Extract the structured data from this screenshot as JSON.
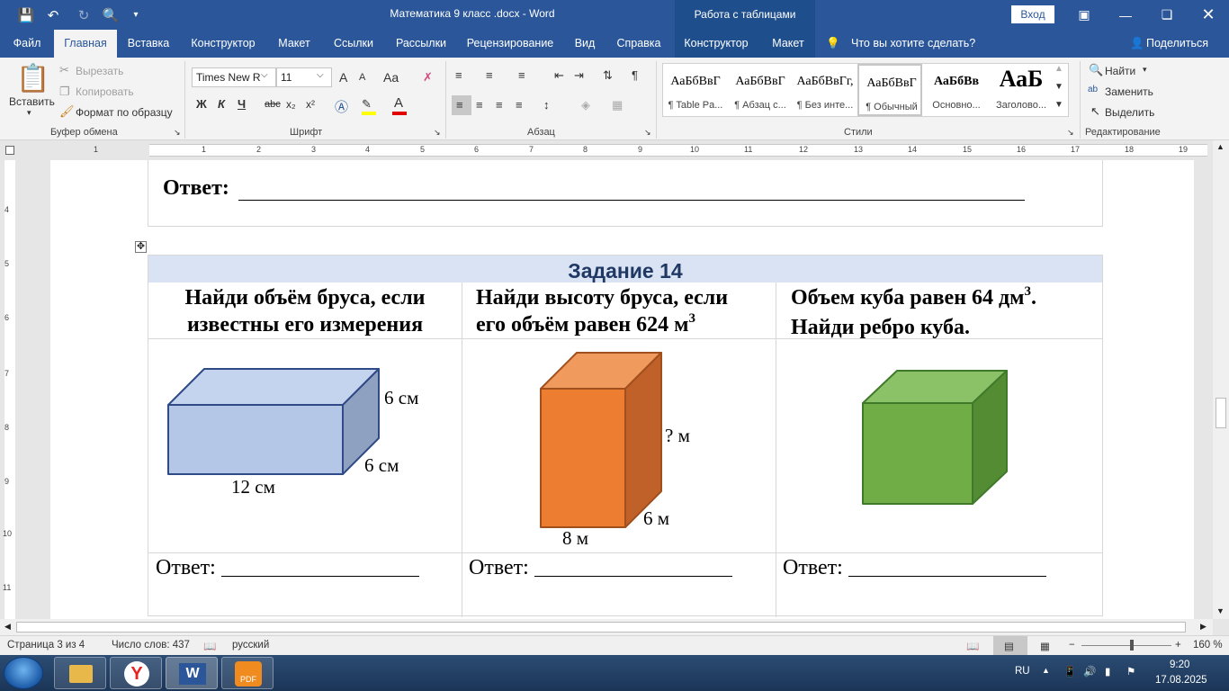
{
  "titlebar": {
    "doc_title": "Математика  9 класс  .docx  -  Word",
    "context_group": "Работа с таблицами",
    "login_label": "Вход"
  },
  "tabs": [
    {
      "label": "Файл"
    },
    {
      "label": "Главная"
    },
    {
      "label": "Вставка"
    },
    {
      "label": "Конструктор"
    },
    {
      "label": "Макет"
    },
    {
      "label": "Ссылки"
    },
    {
      "label": "Рассылки"
    },
    {
      "label": "Рецензирование"
    },
    {
      "label": "Вид"
    },
    {
      "label": "Справка"
    },
    {
      "label": "Конструктор"
    },
    {
      "label": "Макет"
    }
  ],
  "tell_me": "Что вы хотите сделать?",
  "share_label": "Поделиться",
  "ribbon": {
    "clipboard": {
      "paste": "Вставить",
      "cut": "Вырезать",
      "copy": "Копировать",
      "format_painter": "Формат по образцу",
      "group_label": "Буфер обмена"
    },
    "font": {
      "font_name": "Times New R",
      "font_size": "11",
      "bold": "Ж",
      "italic": "К",
      "underline": "Ч",
      "strike": "abc",
      "subscript": "x₂",
      "superscript": "x²",
      "grow": "A",
      "shrink": "A",
      "case": "Aa",
      "group_label": "Шрифт"
    },
    "paragraph": {
      "group_label": "Абзац"
    },
    "styles": {
      "items": [
        {
          "preview": "АаБбВвГ",
          "name": "¶ Table Pa..."
        },
        {
          "preview": "АаБбВвГ",
          "name": "¶ Абзац с..."
        },
        {
          "preview": "АаБбВвГг,",
          "name": "¶ Без инте..."
        },
        {
          "preview": "АаБбВвГ",
          "name": "¶ Обычный"
        },
        {
          "preview": "АаБбВв",
          "name": "Основно..."
        },
        {
          "preview": "АаБ",
          "name": "Заголово..."
        }
      ],
      "group_label": "Стили"
    },
    "editing": {
      "find": "Найти",
      "replace": "Заменить",
      "select": "Выделить",
      "group_label": "Редактирование"
    }
  },
  "ruler": {
    "numbers": [
      "1",
      "1",
      "2",
      "3",
      "4",
      "5",
      "6",
      "7",
      "8",
      "9",
      "10",
      "11",
      "12",
      "13",
      "14",
      "15",
      "16",
      "17",
      "18",
      "19"
    ],
    "vnumbers": [
      "4",
      "5",
      "6",
      "7",
      "8",
      "9",
      "10",
      "11"
    ]
  },
  "document": {
    "answer_label": "Ответ:",
    "task_title": "Задание 14",
    "questions": [
      {
        "line1": "Найди объём бруса, если",
        "line2": "известны его измерения"
      },
      {
        "line1": "Найди высоту бруса, если",
        "line2": "его объём равен 624 м",
        "sup": "3"
      },
      {
        "line1": "Объем куба равен 64 дм",
        "sup": "3",
        "line1_end": ".",
        "line2": "Найди ребро куба."
      }
    ],
    "fig1": {
      "height": "6 см",
      "depth": "6 см",
      "length": "12 см",
      "front_color": "#b4c7e7",
      "top_color": "#c5d4ee",
      "side_color": "#8fa1c0",
      "stroke": "#2f4a86"
    },
    "fig2": {
      "height": "? м",
      "depth": "6 м",
      "width": "8 м",
      "front_color": "#ed7d31",
      "top_color": "#f09a5e",
      "side_color": "#c0612a",
      "stroke": "#a14f1c"
    },
    "fig3": {
      "front_color": "#70ad47",
      "top_color": "#8cc267",
      "side_color": "#548c34",
      "stroke": "#3f7a2a"
    },
    "answers": [
      "Ответ:",
      "Ответ:",
      "Ответ:"
    ]
  },
  "status": {
    "page": "Страница 3 из 4",
    "words": "Число слов: 437",
    "language": "русский",
    "zoom": "160 %"
  },
  "tray": {
    "lang": "RU",
    "time": "9:20",
    "date": "17.08.2025"
  }
}
